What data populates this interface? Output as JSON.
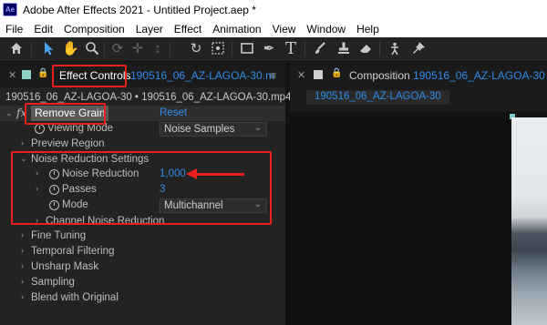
{
  "window": {
    "title": "Adobe After Effects 2021 - Untitled Project.aep *",
    "logo_text": "Ae"
  },
  "menu": [
    "File",
    "Edit",
    "Composition",
    "Layer",
    "Effect",
    "Animation",
    "View",
    "Window",
    "Help"
  ],
  "toolbar": {
    "tools": [
      "home-icon",
      "selection-tool-icon",
      "hand-tool-icon",
      "zoom-tool-icon",
      "orbit-camera-icon",
      "pan-camera-icon",
      "dolly-camera-icon",
      "rotation-tool-icon",
      "pan-behind-icon",
      "rectangle-tool-icon",
      "pen-tool-icon",
      "type-tool-icon",
      "brush-tool-icon",
      "clone-stamp-icon",
      "eraser-icon",
      "roto-brush-icon",
      "puppet-pin-icon"
    ]
  },
  "effect_controls_panel": {
    "tab_label": "Effect Controls",
    "tab_layer": "190516_06_AZ-LAGOA-30.m",
    "header": "190516_06_AZ-LAGOA-30 • 190516_06_AZ-LAGOA-30.mp4",
    "effect": {
      "fx_label": "fx",
      "name": "Remove Grain",
      "reset_label": "Reset",
      "viewing_mode": {
        "label": "Viewing Mode",
        "value": "Noise Samples"
      },
      "preview_region": {
        "label": "Preview Region"
      },
      "noise_reduction_settings": {
        "label": "Noise Reduction Settings",
        "noise_reduction": {
          "label": "Noise Reduction",
          "value": "1,000"
        },
        "passes": {
          "label": "Passes",
          "value": "3"
        },
        "mode": {
          "label": "Mode",
          "value": "Multichannel"
        },
        "channel_noise_reduction": {
          "label": "Channel Noise Reduction"
        }
      },
      "fine_tuning": {
        "label": "Fine Tuning"
      },
      "temporal_filtering": {
        "label": "Temporal Filtering"
      },
      "unsharp_mask": {
        "label": "Unsharp Mask"
      },
      "sampling": {
        "label": "Sampling"
      },
      "blend_with_original": {
        "label": "Blend with Original"
      }
    }
  },
  "composition_panel": {
    "tab_prefix": "Composition",
    "tab_name": "190516_06_AZ-LAGOA-30",
    "comp_button": "190516_06_AZ-LAGOA-30"
  },
  "colors": {
    "accent_blue": "#2d8ceb",
    "annotation_red": "#e8201e",
    "panel_bg": "#232323"
  }
}
